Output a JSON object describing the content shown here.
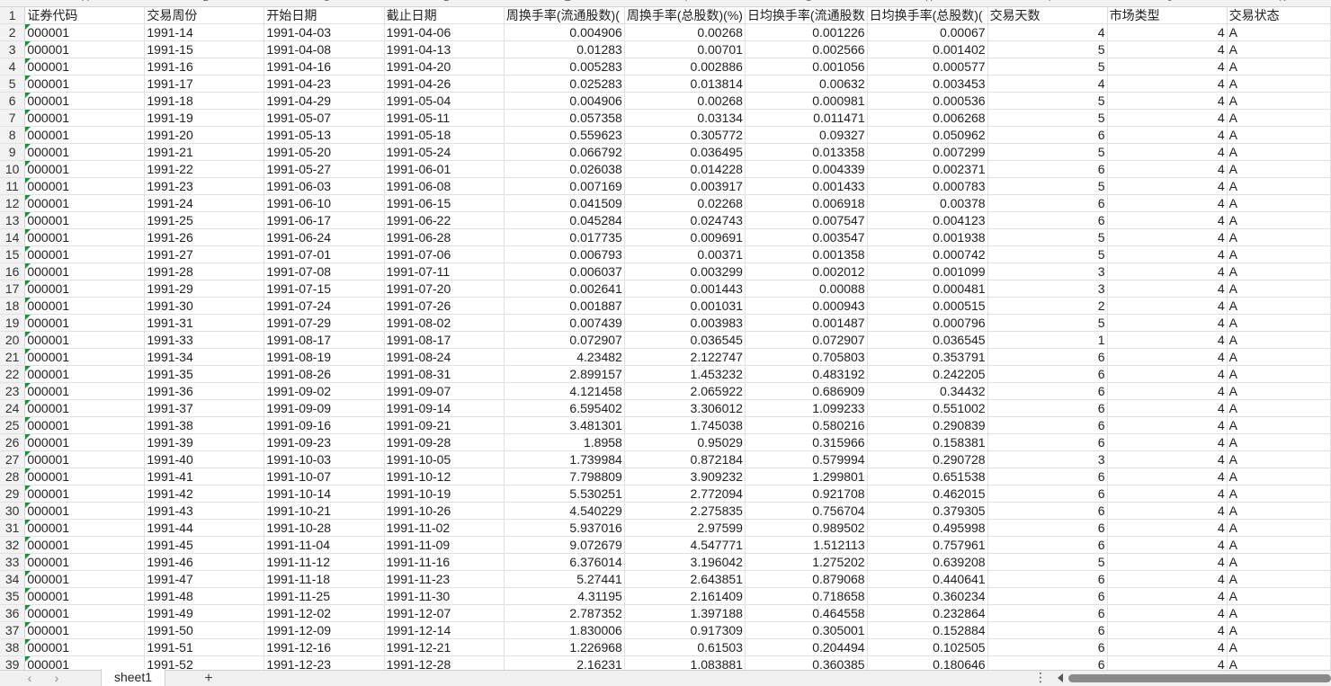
{
  "columns": [
    {
      "letter": "A",
      "header": "证券代码",
      "align": "txt",
      "width": 134
    },
    {
      "letter": "B",
      "header": "交易周份",
      "align": "txt",
      "width": 134
    },
    {
      "letter": "C",
      "header": "开始日期",
      "align": "txt",
      "width": 134
    },
    {
      "letter": "D",
      "header": "截止日期",
      "align": "txt",
      "width": 134
    },
    {
      "letter": "E",
      "header": "周换手率(流通股数)(",
      "align": "num",
      "width": 134
    },
    {
      "letter": "F",
      "header": "周换手率(总股数)(%)",
      "align": "num",
      "width": 134
    },
    {
      "letter": "G",
      "header": "日均换手率(流通股数",
      "align": "num",
      "width": 134
    },
    {
      "letter": "H",
      "header": "日均换手率(总股数)(",
      "align": "num",
      "width": 134
    },
    {
      "letter": "I",
      "header": "交易天数",
      "align": "num",
      "width": 134
    },
    {
      "letter": "J",
      "header": "市场类型",
      "align": "num",
      "width": 134
    },
    {
      "letter": "K",
      "header": "交易状态",
      "align": "txt",
      "width": 116
    }
  ],
  "rows": [
    [
      "000001",
      "1991-14",
      "1991-04-03",
      "1991-04-06",
      "0.004906",
      "0.00268",
      "0.001226",
      "0.00067",
      "4",
      "4",
      "A"
    ],
    [
      "000001",
      "1991-15",
      "1991-04-08",
      "1991-04-13",
      "0.01283",
      "0.00701",
      "0.002566",
      "0.001402",
      "5",
      "4",
      "A"
    ],
    [
      "000001",
      "1991-16",
      "1991-04-16",
      "1991-04-20",
      "0.005283",
      "0.002886",
      "0.001056",
      "0.000577",
      "5",
      "4",
      "A"
    ],
    [
      "000001",
      "1991-17",
      "1991-04-23",
      "1991-04-26",
      "0.025283",
      "0.013814",
      "0.00632",
      "0.003453",
      "4",
      "4",
      "A"
    ],
    [
      "000001",
      "1991-18",
      "1991-04-29",
      "1991-05-04",
      "0.004906",
      "0.00268",
      "0.000981",
      "0.000536",
      "5",
      "4",
      "A"
    ],
    [
      "000001",
      "1991-19",
      "1991-05-07",
      "1991-05-11",
      "0.057358",
      "0.03134",
      "0.011471",
      "0.006268",
      "5",
      "4",
      "A"
    ],
    [
      "000001",
      "1991-20",
      "1991-05-13",
      "1991-05-18",
      "0.559623",
      "0.305772",
      "0.09327",
      "0.050962",
      "6",
      "4",
      "A"
    ],
    [
      "000001",
      "1991-21",
      "1991-05-20",
      "1991-05-24",
      "0.066792",
      "0.036495",
      "0.013358",
      "0.007299",
      "5",
      "4",
      "A"
    ],
    [
      "000001",
      "1991-22",
      "1991-05-27",
      "1991-06-01",
      "0.026038",
      "0.014228",
      "0.004339",
      "0.002371",
      "6",
      "4",
      "A"
    ],
    [
      "000001",
      "1991-23",
      "1991-06-03",
      "1991-06-08",
      "0.007169",
      "0.003917",
      "0.001433",
      "0.000783",
      "5",
      "4",
      "A"
    ],
    [
      "000001",
      "1991-24",
      "1991-06-10",
      "1991-06-15",
      "0.041509",
      "0.02268",
      "0.006918",
      "0.00378",
      "6",
      "4",
      "A"
    ],
    [
      "000001",
      "1991-25",
      "1991-06-17",
      "1991-06-22",
      "0.045284",
      "0.024743",
      "0.007547",
      "0.004123",
      "6",
      "4",
      "A"
    ],
    [
      "000001",
      "1991-26",
      "1991-06-24",
      "1991-06-28",
      "0.017735",
      "0.009691",
      "0.003547",
      "0.001938",
      "5",
      "4",
      "A"
    ],
    [
      "000001",
      "1991-27",
      "1991-07-01",
      "1991-07-06",
      "0.006793",
      "0.00371",
      "0.001358",
      "0.000742",
      "5",
      "4",
      "A"
    ],
    [
      "000001",
      "1991-28",
      "1991-07-08",
      "1991-07-11",
      "0.006037",
      "0.003299",
      "0.002012",
      "0.001099",
      "3",
      "4",
      "A"
    ],
    [
      "000001",
      "1991-29",
      "1991-07-15",
      "1991-07-20",
      "0.002641",
      "0.001443",
      "0.00088",
      "0.000481",
      "3",
      "4",
      "A"
    ],
    [
      "000001",
      "1991-30",
      "1991-07-24",
      "1991-07-26",
      "0.001887",
      "0.001031",
      "0.000943",
      "0.000515",
      "2",
      "4",
      "A"
    ],
    [
      "000001",
      "1991-31",
      "1991-07-29",
      "1991-08-02",
      "0.007439",
      "0.003983",
      "0.001487",
      "0.000796",
      "5",
      "4",
      "A"
    ],
    [
      "000001",
      "1991-33",
      "1991-08-17",
      "1991-08-17",
      "0.072907",
      "0.036545",
      "0.072907",
      "0.036545",
      "1",
      "4",
      "A"
    ],
    [
      "000001",
      "1991-34",
      "1991-08-19",
      "1991-08-24",
      "4.23482",
      "2.122747",
      "0.705803",
      "0.353791",
      "6",
      "4",
      "A"
    ],
    [
      "000001",
      "1991-35",
      "1991-08-26",
      "1991-08-31",
      "2.899157",
      "1.453232",
      "0.483192",
      "0.242205",
      "6",
      "4",
      "A"
    ],
    [
      "000001",
      "1991-36",
      "1991-09-02",
      "1991-09-07",
      "4.121458",
      "2.065922",
      "0.686909",
      "0.34432",
      "6",
      "4",
      "A"
    ],
    [
      "000001",
      "1991-37",
      "1991-09-09",
      "1991-09-14",
      "6.595402",
      "3.306012",
      "1.099233",
      "0.551002",
      "6",
      "4",
      "A"
    ],
    [
      "000001",
      "1991-38",
      "1991-09-16",
      "1991-09-21",
      "3.481301",
      "1.745038",
      "0.580216",
      "0.290839",
      "6",
      "4",
      "A"
    ],
    [
      "000001",
      "1991-39",
      "1991-09-23",
      "1991-09-28",
      "1.8958",
      "0.95029",
      "0.315966",
      "0.158381",
      "6",
      "4",
      "A"
    ],
    [
      "000001",
      "1991-40",
      "1991-10-03",
      "1991-10-05",
      "1.739984",
      "0.872184",
      "0.579994",
      "0.290728",
      "3",
      "4",
      "A"
    ],
    [
      "000001",
      "1991-41",
      "1991-10-07",
      "1991-10-12",
      "7.798809",
      "3.909232",
      "1.299801",
      "0.651538",
      "6",
      "4",
      "A"
    ],
    [
      "000001",
      "1991-42",
      "1991-10-14",
      "1991-10-19",
      "5.530251",
      "2.772094",
      "0.921708",
      "0.462015",
      "6",
      "4",
      "A"
    ],
    [
      "000001",
      "1991-43",
      "1991-10-21",
      "1991-10-26",
      "4.540229",
      "2.275835",
      "0.756704",
      "0.379305",
      "6",
      "4",
      "A"
    ],
    [
      "000001",
      "1991-44",
      "1991-10-28",
      "1991-11-02",
      "5.937016",
      "2.97599",
      "0.989502",
      "0.495998",
      "6",
      "4",
      "A"
    ],
    [
      "000001",
      "1991-45",
      "1991-11-04",
      "1991-11-09",
      "9.072679",
      "4.547771",
      "1.512113",
      "0.757961",
      "6",
      "4",
      "A"
    ],
    [
      "000001",
      "1991-46",
      "1991-11-12",
      "1991-11-16",
      "6.376014",
      "3.196042",
      "1.275202",
      "0.639208",
      "5",
      "4",
      "A"
    ],
    [
      "000001",
      "1991-47",
      "1991-11-18",
      "1991-11-23",
      "5.27441",
      "2.643851",
      "0.879068",
      "0.440641",
      "6",
      "4",
      "A"
    ],
    [
      "000001",
      "1991-48",
      "1991-11-25",
      "1991-11-30",
      "4.31195",
      "2.161409",
      "0.718658",
      "0.360234",
      "6",
      "4",
      "A"
    ],
    [
      "000001",
      "1991-49",
      "1991-12-02",
      "1991-12-07",
      "2.787352",
      "1.397188",
      "0.464558",
      "0.232864",
      "6",
      "4",
      "A"
    ],
    [
      "000001",
      "1991-50",
      "1991-12-09",
      "1991-12-14",
      "1.830006",
      "0.917309",
      "0.305001",
      "0.152884",
      "6",
      "4",
      "A"
    ],
    [
      "000001",
      "1991-51",
      "1991-12-16",
      "1991-12-21",
      "1.226968",
      "0.61503",
      "0.204494",
      "0.102505",
      "6",
      "4",
      "A"
    ],
    [
      "000001",
      "1991-52",
      "1991-12-23",
      "1991-12-28",
      "2.16231",
      "1.083881",
      "0.360385",
      "0.180646",
      "6",
      "4",
      "A"
    ]
  ],
  "footer": {
    "sheet_tab": "sheet1",
    "add_symbol": "+",
    "prev_symbol": "‹",
    "next_symbol": "›",
    "menu_symbol": "⋮"
  }
}
